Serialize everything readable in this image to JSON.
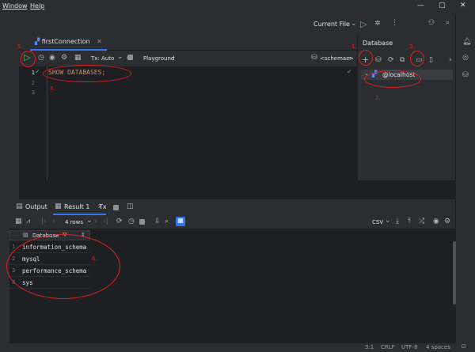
{
  "menu": {
    "window": "Window",
    "help": "Help"
  },
  "run_config": {
    "label": "Current File"
  },
  "editor": {
    "tab_label": "firstConnection",
    "tx_label": "Tx: Auto",
    "playground_label": "Playground",
    "schemas_label": "<schemas>",
    "lines": [
      "1",
      "2",
      "3"
    ],
    "code_line1": "SHOW DATABASES;"
  },
  "database_panel": {
    "title": "Database",
    "tree_root": "@localhost"
  },
  "annotations": {
    "n1": "1.",
    "n2": "2.",
    "n3": "3.",
    "n4": "4.",
    "n5": "5.",
    "n6": "6."
  },
  "bottom": {
    "output_tab": "Output",
    "result_tab": "Result 1",
    "tx_tab": "Tx",
    "rows_label": "4 rows",
    "csv_label": "CSV",
    "column_header": "Database",
    "rows": [
      {
        "num": "1",
        "value": "information_schema"
      },
      {
        "num": "2",
        "value": "mysql"
      },
      {
        "num": "3",
        "value": "performance_schema"
      },
      {
        "num": "4",
        "value": "sys"
      }
    ]
  },
  "status": {
    "position": "3:1",
    "line_ending": "CRLF",
    "encoding": "UTF-8",
    "indent": "4 spaces"
  },
  "colors": {
    "accent": "#3574f0",
    "annotation": "#e02020",
    "run_green": "#5fb865"
  }
}
